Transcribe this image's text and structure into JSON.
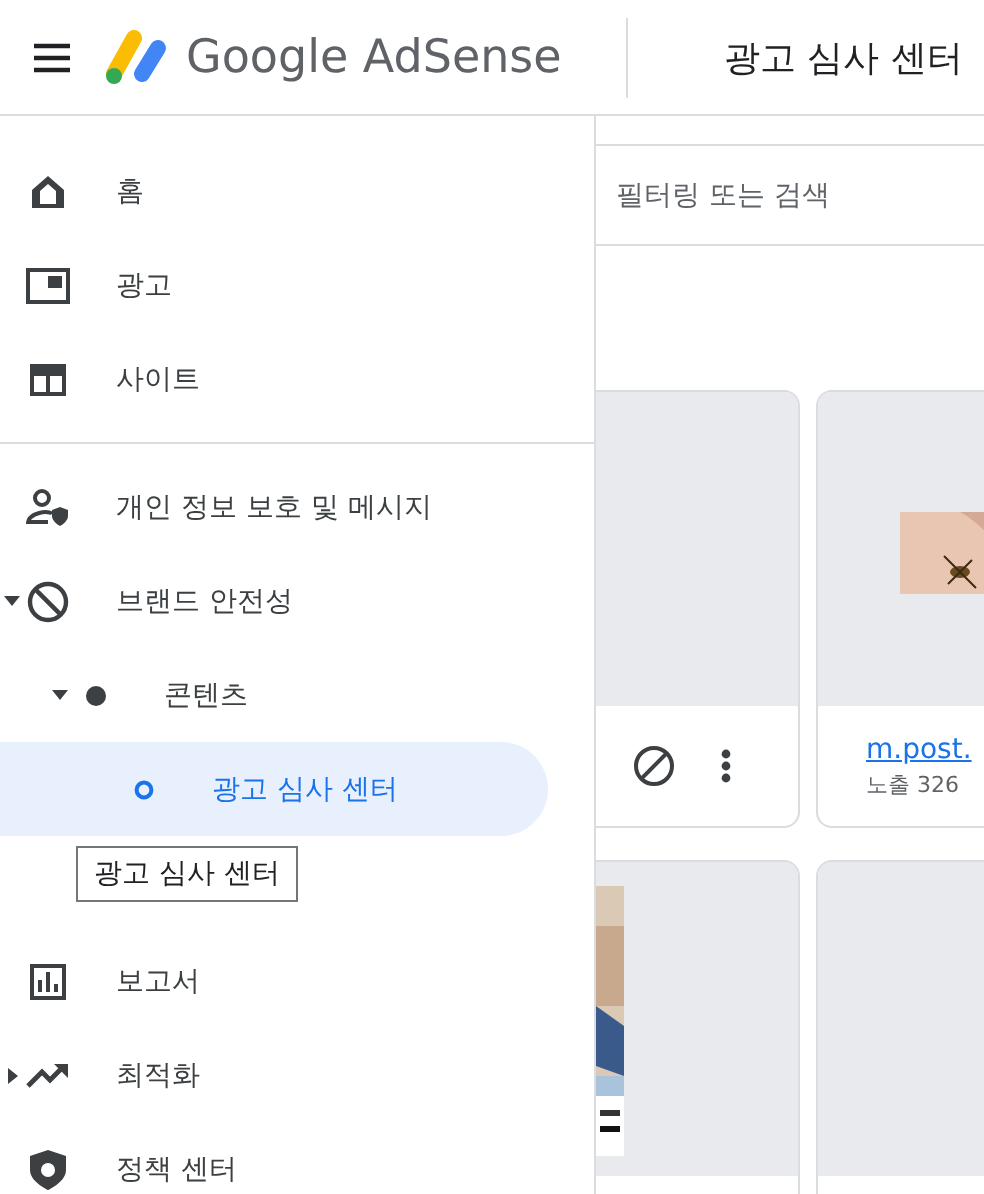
{
  "header": {
    "product": "Google AdSense",
    "page_title": "광고 심사 센터"
  },
  "sidebar": {
    "items": [
      {
        "kind": "home",
        "label": "홈",
        "selected": false
      },
      {
        "kind": "ads",
        "label": "광고",
        "selected": false
      },
      {
        "kind": "sites",
        "label": "사이트",
        "selected": false
      },
      {
        "kind": "divider"
      },
      {
        "kind": "privacy",
        "label": "개인 정보 보호 및 메시지",
        "selected": false
      },
      {
        "kind": "block",
        "label": "브랜드 안전성",
        "selected": false,
        "expanded": true,
        "children": [
          {
            "kind": "dot",
            "label": "콘텐츠",
            "selected": false,
            "expanded": true,
            "children": [
              {
                "kind": "ring",
                "label": "광고 심사 센터",
                "selected": true
              }
            ]
          }
        ]
      },
      {
        "kind": "reports",
        "label": "보고서",
        "selected": false
      },
      {
        "kind": "trend",
        "label": "최적화",
        "selected": false,
        "expanded": false
      },
      {
        "kind": "policy",
        "label": "정책 센터",
        "selected": false
      }
    ]
  },
  "tooltip": "광고 심사 센터",
  "filter": {
    "placeholder": "필터링 또는 검색"
  },
  "cards": [
    {
      "kind": "actions"
    },
    {
      "kind": "info",
      "link": "m.post.",
      "reading": "노출 326"
    },
    {
      "kind": "picture"
    },
    {
      "kind": "blank"
    }
  ]
}
